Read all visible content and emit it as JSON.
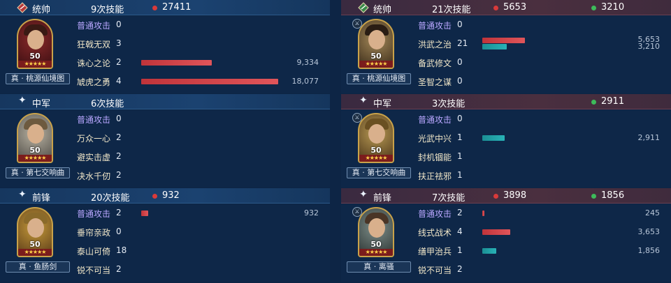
{
  "colors": {
    "background": "#0d2545",
    "damage": "#d93a3a",
    "heal": "#3dbb5a",
    "basic_attack": "#b9a7ff",
    "gold_border": "#c9a24a"
  },
  "left": {
    "sections": [
      {
        "role": "统帅",
        "role_icon": "commander-icon",
        "skill_count": "9次技能",
        "damage": "27411",
        "heal": "",
        "level": "50",
        "stars": "★★★★★",
        "gear": "真 · 桃源仙境图",
        "skills": [
          {
            "name": "普通攻击",
            "count": "0",
            "damage": null,
            "damage_label": "",
            "heal": null,
            "heal_label": ""
          },
          {
            "name": "狂戟无双",
            "count": "3",
            "damage": null,
            "damage_label": "",
            "heal": null,
            "heal_label": ""
          },
          {
            "name": "诛心之论",
            "count": "2",
            "damage": 9334,
            "damage_label": "9,334",
            "heal": null,
            "heal_label": ""
          },
          {
            "name": "虓虎之勇",
            "count": "4",
            "damage": 18077,
            "damage_label": "18,077",
            "heal": null,
            "heal_label": ""
          }
        ]
      },
      {
        "role": "中军",
        "role_icon": "star-icon",
        "skill_count": "6次技能",
        "damage": "",
        "heal": "",
        "level": "50",
        "stars": "★★★★★",
        "gear": "真 · 第七交响曲",
        "skills": [
          {
            "name": "普通攻击",
            "count": "0",
            "damage": null,
            "damage_label": "",
            "heal": null,
            "heal_label": ""
          },
          {
            "name": "万众一心",
            "count": "2",
            "damage": null,
            "damage_label": "",
            "heal": null,
            "heal_label": ""
          },
          {
            "name": "避实击虚",
            "count": "2",
            "damage": null,
            "damage_label": "",
            "heal": null,
            "heal_label": ""
          },
          {
            "name": "决水千仞",
            "count": "2",
            "damage": null,
            "damage_label": "",
            "heal": null,
            "heal_label": ""
          }
        ]
      },
      {
        "role": "前锋",
        "role_icon": "star-icon",
        "skill_count": "20次技能",
        "damage": "932",
        "heal": "",
        "level": "50",
        "stars": "★★★★★",
        "gear": "真 · 鱼肠剑",
        "skills": [
          {
            "name": "普通攻击",
            "count": "2",
            "damage": 932,
            "damage_label": "932",
            "heal": null,
            "heal_label": ""
          },
          {
            "name": "垂帘亲政",
            "count": "0",
            "damage": null,
            "damage_label": "",
            "heal": null,
            "heal_label": ""
          },
          {
            "name": "泰山可倚",
            "count": "18",
            "damage": null,
            "damage_label": "",
            "heal": null,
            "heal_label": ""
          },
          {
            "name": "锐不可当",
            "count": "2",
            "damage": null,
            "damage_label": "",
            "heal": null,
            "heal_label": ""
          }
        ]
      }
    ]
  },
  "right": {
    "sections": [
      {
        "role": "统帅",
        "role_icon": "commander-icon",
        "skill_count": "21次技能",
        "damage": "5653",
        "heal": "3210",
        "level": "50",
        "stars": "★★★★★",
        "gear": "真 · 桃源仙境图",
        "skills": [
          {
            "name": "普通攻击",
            "count": "0",
            "damage": null,
            "damage_label": "",
            "heal": null,
            "heal_label": ""
          },
          {
            "name": "洪武之治",
            "count": "21",
            "damage": 5653,
            "damage_label": "5,653",
            "heal": 3210,
            "heal_label": "3,210"
          },
          {
            "name": "备武修文",
            "count": "0",
            "damage": null,
            "damage_label": "",
            "heal": null,
            "heal_label": ""
          },
          {
            "name": "圣智之谋",
            "count": "0",
            "damage": null,
            "damage_label": "",
            "heal": null,
            "heal_label": ""
          }
        ]
      },
      {
        "role": "中军",
        "role_icon": "star-icon",
        "skill_count": "3次技能",
        "damage": "",
        "heal": "2911",
        "level": "50",
        "stars": "★★★★★",
        "gear": "真 · 第七交响曲",
        "skills": [
          {
            "name": "普通攻击",
            "count": "0",
            "damage": null,
            "damage_label": "",
            "heal": null,
            "heal_label": ""
          },
          {
            "name": "光武中兴",
            "count": "1",
            "damage": null,
            "damage_label": "",
            "heal": 2911,
            "heal_label": "2,911"
          },
          {
            "name": "封机锢能",
            "count": "1",
            "damage": null,
            "damage_label": "",
            "heal": null,
            "heal_label": ""
          },
          {
            "name": "扶正祛邪",
            "count": "1",
            "damage": null,
            "damage_label": "",
            "heal": null,
            "heal_label": ""
          }
        ]
      },
      {
        "role": "前锋",
        "role_icon": "star-icon",
        "skill_count": "7次技能",
        "damage": "3898",
        "heal": "1856",
        "level": "50",
        "stars": "★★★★★",
        "gear": "真 · 离骚",
        "skills": [
          {
            "name": "普通攻击",
            "count": "2",
            "damage": 245,
            "damage_label": "245",
            "heal": null,
            "heal_label": ""
          },
          {
            "name": "线式战术",
            "count": "4",
            "damage": 3653,
            "damage_label": "3,653",
            "heal": null,
            "heal_label": ""
          },
          {
            "name": "缮甲治兵",
            "count": "1",
            "damage": null,
            "damage_label": "",
            "heal": 1856,
            "heal_label": "1,856"
          },
          {
            "name": "锐不可当",
            "count": "2",
            "damage": null,
            "damage_label": "",
            "heal": null,
            "heal_label": ""
          }
        ]
      }
    ]
  }
}
